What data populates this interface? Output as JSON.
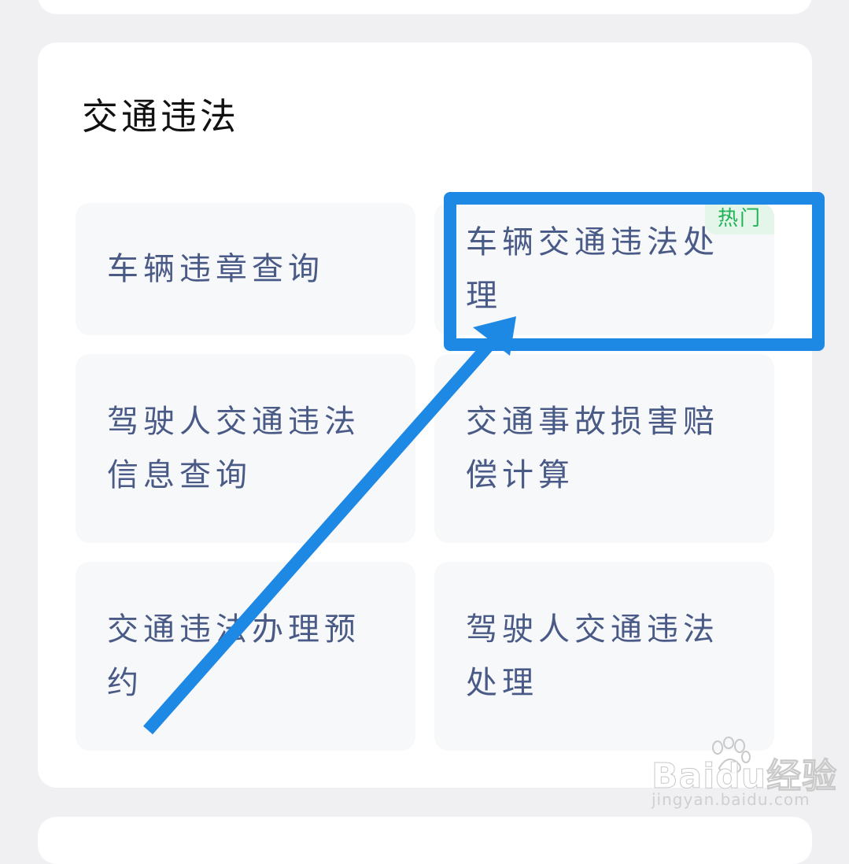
{
  "section": {
    "title": "交通违法"
  },
  "services": [
    {
      "label": "车辆违章查询",
      "badge": ""
    },
    {
      "label": "车辆交通违法处理",
      "badge": "热门"
    },
    {
      "label": "驾驶人交通违法信息查询",
      "badge": ""
    },
    {
      "label": "交通事故损害赔偿计算",
      "badge": ""
    },
    {
      "label": "交通违法办理预约",
      "badge": ""
    },
    {
      "label": "驾驶人交通违法处理",
      "badge": ""
    }
  ],
  "watermark": {
    "logo": "Baidu经验",
    "url": "jingyan.baidu.com"
  },
  "colors": {
    "annotation": "#1e88e5",
    "tile_text": "#4a5a86",
    "badge_text": "#1fb356",
    "badge_bg": "#e4f6ea"
  },
  "icons": {
    "annotation_arrow": "arrow-icon",
    "watermark_paw": "paw-icon"
  }
}
